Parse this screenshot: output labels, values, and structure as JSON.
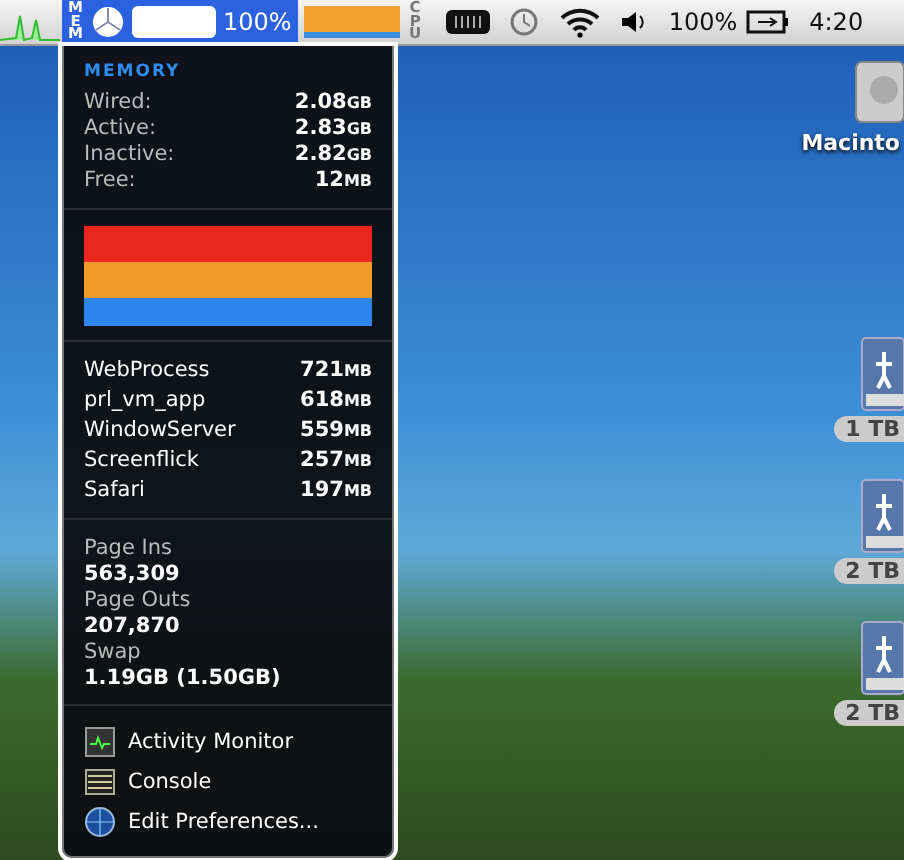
{
  "menu_bar": {
    "memory_extra": {
      "label": "MEM",
      "reading": "100%",
      "selected": true
    },
    "cpu_extra": {
      "label": "CPU"
    },
    "battery_reading": "100%",
    "clock": "4:20"
  },
  "memory_menu": {
    "title": "MEMORY",
    "memory_rows": [
      {
        "label": "Wired:",
        "value": "2.08",
        "unit": "GB"
      },
      {
        "label": "Active:",
        "value": "2.83",
        "unit": "GB"
      },
      {
        "label": "Inactive:",
        "value": "2.82",
        "unit": "GB"
      },
      {
        "label": "Free:",
        "value": "12",
        "unit": "MB"
      }
    ],
    "processes": [
      {
        "name": "WebProcess",
        "value": "721",
        "unit": "MB"
      },
      {
        "name": "prl_vm_app",
        "value": "618",
        "unit": "MB"
      },
      {
        "name": "WindowServer",
        "value": "559",
        "unit": "MB"
      },
      {
        "name": "Screenflick",
        "value": "257",
        "unit": "MB"
      },
      {
        "name": "Safari",
        "value": "197",
        "unit": "MB"
      }
    ],
    "stats": [
      {
        "label": "Page Ins",
        "value": "563,309"
      },
      {
        "label": "Page Outs",
        "value": "207,870"
      },
      {
        "label": "Swap",
        "value": "1.19GB (1.50GB)"
      }
    ],
    "actions": [
      {
        "kind": "monitor",
        "label": "Activity Monitor"
      },
      {
        "kind": "console",
        "label": "Console"
      },
      {
        "kind": "globe",
        "label": "Edit Preferences..."
      }
    ]
  },
  "desktop_icons": [
    {
      "kind": "hard-disk",
      "label": "Macinto"
    },
    {
      "kind": "network-drive",
      "label": "1 TB"
    },
    {
      "kind": "network-drive",
      "label": "2 TB"
    },
    {
      "kind": "network-drive",
      "label": "2 TB"
    }
  ]
}
